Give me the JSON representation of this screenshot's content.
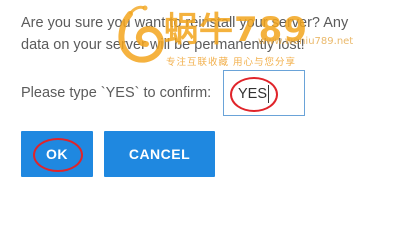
{
  "dialog": {
    "message_line1": "Are you sure you want to reinstall your server? Any",
    "message_line2": "data on your server will be permanently lost!",
    "confirm_label": "Please type `YES` to confirm:",
    "confirm_value": "YES",
    "ok_label": "OK",
    "cancel_label": "CANCEL"
  },
  "watermark": {
    "brand": "蜗牛789",
    "url": "www.woniu789.net",
    "tagline": "专注互联收藏  用心与您分享"
  },
  "colors": {
    "button": "#1f88e0",
    "input_border": "#6aa3d8",
    "annotation": "#e0242a",
    "watermark": "#f3a51d"
  }
}
